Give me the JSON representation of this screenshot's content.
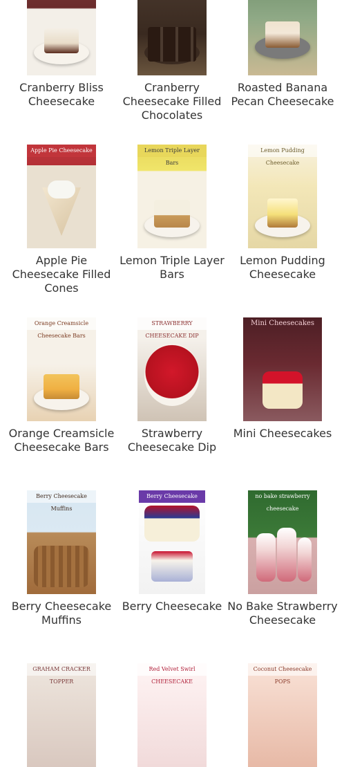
{
  "recipes": [
    {
      "title": "Cranberry Bliss Cheesecake"
    },
    {
      "title": "Cranberry Cheesecake Filled Chocolates"
    },
    {
      "title": "Roasted Banana Pecan Cheesecake"
    },
    {
      "title": "Apple Pie Cheesecake Filled Cones",
      "overlay": "Apple Pie Cheesecake"
    },
    {
      "title": "Lemon Triple Layer Bars",
      "overlay": "Lemon Triple Layer Bars"
    },
    {
      "title": "Lemon Pudding Cheesecake",
      "overlay": "Lemon Pudding Cheesecake"
    },
    {
      "title": "Orange Creamsicle Cheesecake Bars",
      "overlay": "Orange Creamsicle Cheesecake Bars"
    },
    {
      "title": "Strawberry Cheesecake Dip",
      "overlay": "STRAWBERRY CHEESECAKE DIP"
    },
    {
      "title": "Mini Cheesecakes",
      "overlay": "Mini Cheesecakes"
    },
    {
      "title": "Berry Cheesecake Muffins",
      "overlay": "Berry Cheesecake Muffins"
    },
    {
      "title": "Berry Cheesecake",
      "overlay": "Berry Cheesecake"
    },
    {
      "title": "No Bake Strawberry Cheesecake",
      "overlay": "no bake strawberry cheesecake"
    },
    {
      "title": "",
      "overlay": "GRAHAM CRACKER TOPPER"
    },
    {
      "title": "",
      "overlay": "Red Velvet Swirl CHEESECAKE"
    },
    {
      "title": "",
      "overlay": "Coconut Cheesecake POPS"
    }
  ],
  "colors": {
    "text": "#333333",
    "bg": "#ffffff"
  }
}
